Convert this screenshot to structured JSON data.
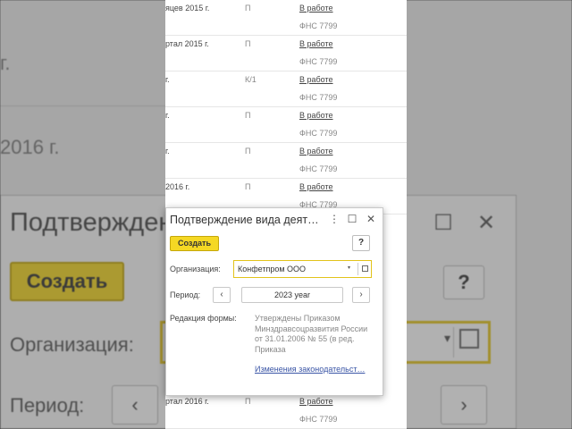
{
  "background": {
    "side_years": [
      "г.",
      "2016 г."
    ],
    "dialog": {
      "title": "Подтверждение вида деят…",
      "create_button": "Создать",
      "help_button": "?",
      "org_label": "Организация:",
      "period_label": "Период:",
      "prev": "‹",
      "next": "›",
      "dropdown_glyph": "▾",
      "close_glyph": "✕",
      "maximize_glyph": "☐"
    }
  },
  "list": {
    "rows": [
      {
        "period": "яцев 2015 г.",
        "type": "П",
        "status": "В работе",
        "agency": "ФНС 7799"
      },
      {
        "period": "ртал 2015 г.",
        "type": "П",
        "status": "В работе",
        "agency": "ФНС 7799"
      },
      {
        "period": "г.",
        "type": "К/1",
        "status": "В работе",
        "agency": "ФНС 7799"
      },
      {
        "period": "г.",
        "type": "П",
        "status": "В работе",
        "agency": "ФНС 7799"
      },
      {
        "period": "г.",
        "type": "П",
        "status": "В работе",
        "agency": "ФНС 7799"
      },
      {
        "period": "2016 г.",
        "type": "П",
        "status": "В работе",
        "agency": "ФНС 7799"
      },
      {
        "period": "ртал 2016 г.",
        "type": "П",
        "status": "В работе",
        "agency": "ФНС 7799"
      }
    ]
  },
  "dialog": {
    "title": "Подтверждение вида деят…",
    "more_glyph": "⋮",
    "maximize_glyph": "☐",
    "close_glyph": "✕",
    "create_button": "Создать",
    "help_button": "?",
    "org_label": "Организация:",
    "org_value": "Конфетпром ООО",
    "dropdown_glyph": "▾",
    "period_label": "Период:",
    "prev": "‹",
    "period_value": "2023 year",
    "next": "›",
    "edition_label": "Редакция формы:",
    "edition_text": "Утверждены Приказом Минздравсоцразвития России от 31.01.2006 № 55 (в ред. Приказа",
    "law_link": "Изменения законодательст…"
  },
  "colors": {
    "accent_yellow": "#f5d824",
    "link_blue": "#3a55a6"
  }
}
